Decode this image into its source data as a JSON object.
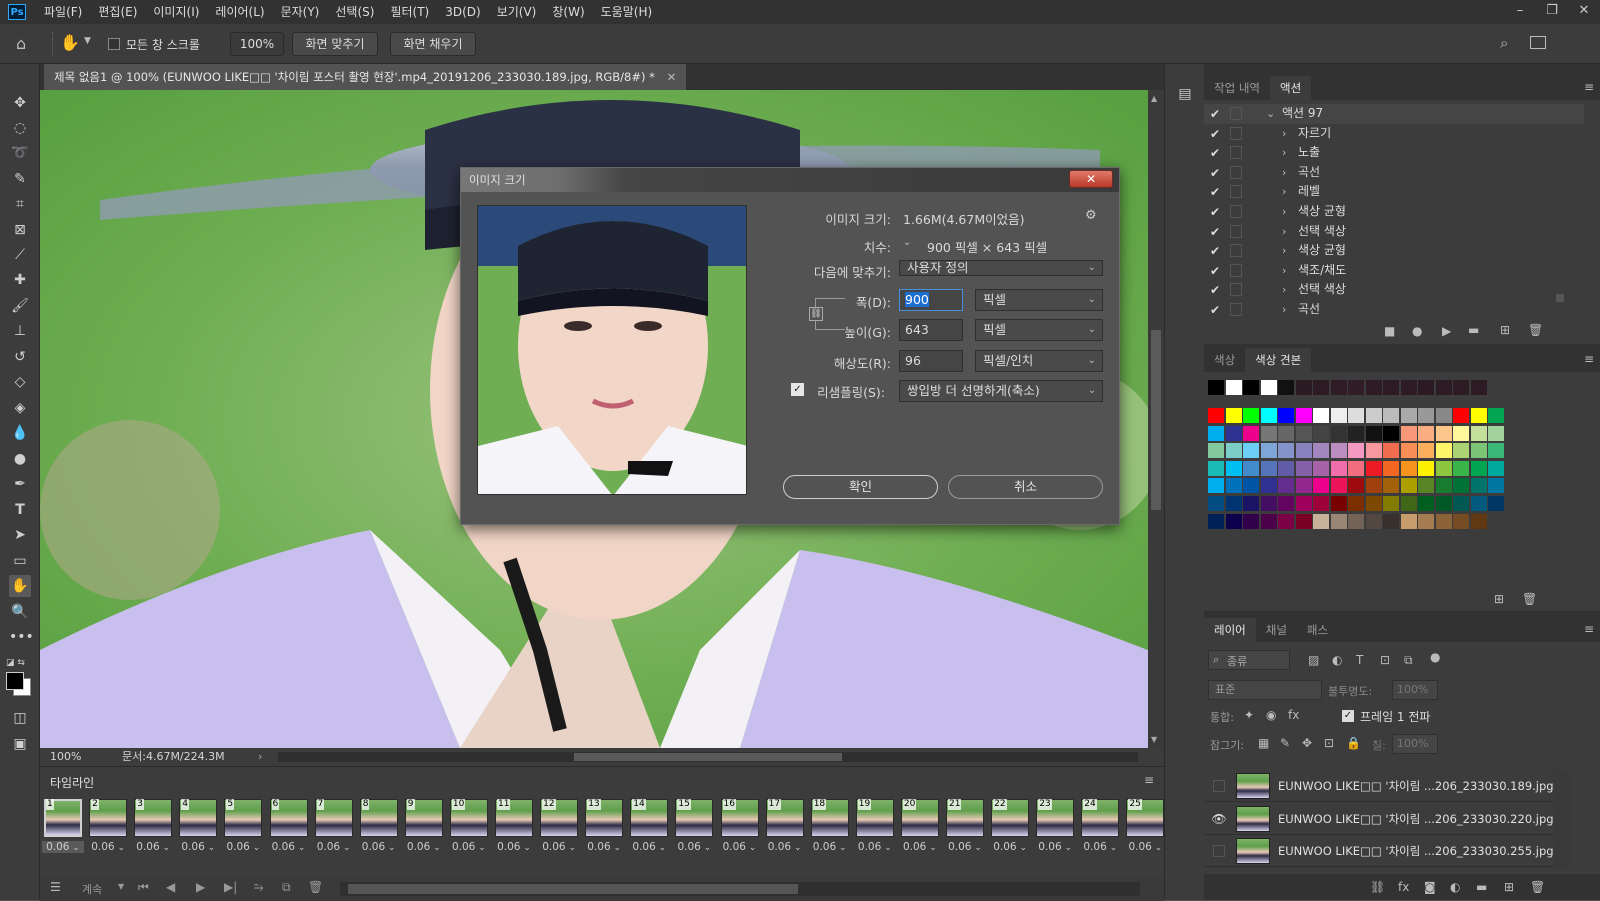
{
  "app": {
    "logo": "Ps"
  },
  "menu": [
    "파일(F)",
    "편집(E)",
    "이미지(I)",
    "레이어(L)",
    "문자(Y)",
    "선택(S)",
    "필터(T)",
    "3D(D)",
    "보기(V)",
    "창(W)",
    "도움말(H)"
  ],
  "options": {
    "scroll_all_label": "모든 창 스크롤",
    "zoom_value": "100%",
    "fit_screen": "화면 맞추기",
    "fill_screen": "화면 채우기"
  },
  "document": {
    "tab_title": "제목 없음1 @ 100% (EUNWOO LIKE□□ '차이림 포스터 촬영 현장'.mp4_20191206_233030.189.jpg, RGB/8#) *"
  },
  "status": {
    "zoom": "100%",
    "doc_size": "문서:4.67M/224.3M"
  },
  "timeline": {
    "title": "타임라인",
    "loop": "계속",
    "frames": [
      {
        "n": "1",
        "d": "0.06"
      },
      {
        "n": "2",
        "d": "0.06"
      },
      {
        "n": "3",
        "d": "0.06"
      },
      {
        "n": "4",
        "d": "0.06"
      },
      {
        "n": "5",
        "d": "0.06"
      },
      {
        "n": "6",
        "d": "0.06"
      },
      {
        "n": "7",
        "d": "0.06"
      },
      {
        "n": "8",
        "d": "0.06"
      },
      {
        "n": "9",
        "d": "0.06"
      },
      {
        "n": "10",
        "d": "0.06"
      },
      {
        "n": "11",
        "d": "0.06"
      },
      {
        "n": "12",
        "d": "0.06"
      },
      {
        "n": "13",
        "d": "0.06"
      },
      {
        "n": "14",
        "d": "0.06"
      },
      {
        "n": "15",
        "d": "0.06"
      },
      {
        "n": "16",
        "d": "0.06"
      },
      {
        "n": "17",
        "d": "0.06"
      },
      {
        "n": "18",
        "d": "0.06"
      },
      {
        "n": "19",
        "d": "0.06"
      },
      {
        "n": "20",
        "d": "0.06"
      },
      {
        "n": "21",
        "d": "0.06"
      },
      {
        "n": "22",
        "d": "0.06"
      },
      {
        "n": "23",
        "d": "0.06"
      },
      {
        "n": "24",
        "d": "0.06"
      },
      {
        "n": "25",
        "d": "0.06"
      }
    ]
  },
  "actions_panel": {
    "tabs": [
      "작업 내역",
      "액션"
    ],
    "set_name": "액션 97",
    "items": [
      "자르기",
      "노출",
      "곡선",
      "레벨",
      "색상 균형",
      "선택 색상",
      "색상 균형",
      "색조/채도",
      "선택 색상",
      "곡선"
    ]
  },
  "swatches_panel": {
    "tabs": [
      "색상",
      "색상 견본"
    ],
    "recent": [
      "#000000",
      "#ffffff",
      "#000000",
      "#ffffff",
      "#111111",
      "#2a1a22",
      "#2d1b24",
      "#2f1c26",
      "#301d27",
      "#2e1b25",
      "#2c1a24",
      "#2d1b25",
      "#2b1a23",
      "#2c1b24",
      "#2e1c25",
      "#2d1b24"
    ],
    "rows": [
      [
        "#ff0000",
        "#ffff00",
        "#00ff00",
        "#00ffff",
        "#0000ff",
        "#ff00ff",
        "#ffffff",
        "#eeeeee",
        "#dddddd",
        "#cccccc",
        "#bbbbbb",
        "#aaaaaa",
        "#999999",
        "#888888",
        "#ff0000",
        "#ffff00",
        "#00a651"
      ],
      [
        "#00aeef",
        "#2e3192",
        "#ec008c",
        "#777777",
        "#666666",
        "#555555",
        "#444444",
        "#333333",
        "#222222",
        "#111111",
        "#000000",
        "#f7977a",
        "#f9ad81",
        "#fdc68a",
        "#fff79a",
        "#c4df9b",
        "#a3d39c"
      ],
      [
        "#82ca9d",
        "#7bcdc8",
        "#6ecff6",
        "#7ea7d8",
        "#8493ca",
        "#8882be",
        "#a187be",
        "#bc8dbf",
        "#f49ac2",
        "#f6989d",
        "#f26c4f",
        "#f68e56",
        "#fbaf5d",
        "#fff568",
        "#acd373",
        "#7cc576",
        "#3bb878"
      ],
      [
        "#1abbb4",
        "#00bff3",
        "#438ccb",
        "#5574b9",
        "#605ca8",
        "#855fa8",
        "#a763a8",
        "#f06eaa",
        "#f26d7d",
        "#ed1c24",
        "#f26522",
        "#f7941d",
        "#fff200",
        "#8dc63f",
        "#39b54a",
        "#00a651",
        "#00a99d"
      ],
      [
        "#00aeef",
        "#0072bc",
        "#0054a6",
        "#2e3192",
        "#662d91",
        "#92278f",
        "#ec008c",
        "#ed145b",
        "#9e0b0f",
        "#a0410d",
        "#a36209",
        "#aba000",
        "#598527",
        "#197b30",
        "#007236",
        "#00746b",
        "#0076a3"
      ],
      [
        "#004b80",
        "#003471",
        "#1b1464",
        "#440e62",
        "#630460",
        "#9e005d",
        "#9e0039",
        "#790000",
        "#7b2e00",
        "#7d4900",
        "#827b00",
        "#406618",
        "#005e20",
        "#005826",
        "#005952",
        "#005b7f",
        "#003663"
      ],
      [
        "#002157",
        "#0d004c",
        "#32004b",
        "#4b0049",
        "#7b0046",
        "#7a0026",
        "#c7b299",
        "#998675",
        "#736357",
        "#534741",
        "#37302d",
        "#c69c6d",
        "#a67c52",
        "#8c6239",
        "#754c24",
        "#603913"
      ]
    ]
  },
  "layers_panel": {
    "tabs": [
      "레이어",
      "채널",
      "패스"
    ],
    "filter_label": "종류",
    "blend_mode": "표준",
    "opacity_label": "불투명도:",
    "opacity_value": "100%",
    "unify_label": "통합:",
    "propagate_label": "프레임 1 전파",
    "lock_label": "잠그기:",
    "fill_label": "칠:",
    "fill_value": "100%",
    "layers": [
      {
        "name": "EUNWOO LIKE□□ '차이림 ...206_233030.189.jpg",
        "visible": false
      },
      {
        "name": "EUNWOO LIKE□□ '차이림 ...206_233030.220.jpg",
        "visible": true
      },
      {
        "name": "EUNWOO LIKE□□ '차이림 ...206_233030.255.jpg",
        "visible": false
      }
    ]
  },
  "dialog": {
    "title": "이미지 크기",
    "image_size_label": "이미지 크기:",
    "image_size_value": "1.66M(4.67M이었음)",
    "dimensions_label": "치수:",
    "dimensions_value": "900 픽셀  ×  643 픽셀",
    "fit_label": "다음에 맞추기:",
    "fit_value": "사용자 정의",
    "width_label": "폭(D):",
    "width_value": "900",
    "width_unit": "픽셀",
    "height_label": "높이(G):",
    "height_value": "643",
    "height_unit": "픽셀",
    "resolution_label": "해상도(R):",
    "resolution_value": "96",
    "resolution_unit": "픽셀/인치",
    "resample_label": "리샘플링(S):",
    "resample_value": "쌍입방 더 선명하게(축소)",
    "ok": "확인",
    "cancel": "취소"
  },
  "colors": {
    "accent": "#31a8ff",
    "selection": "#1c6fd1",
    "close": "#c8483a"
  }
}
